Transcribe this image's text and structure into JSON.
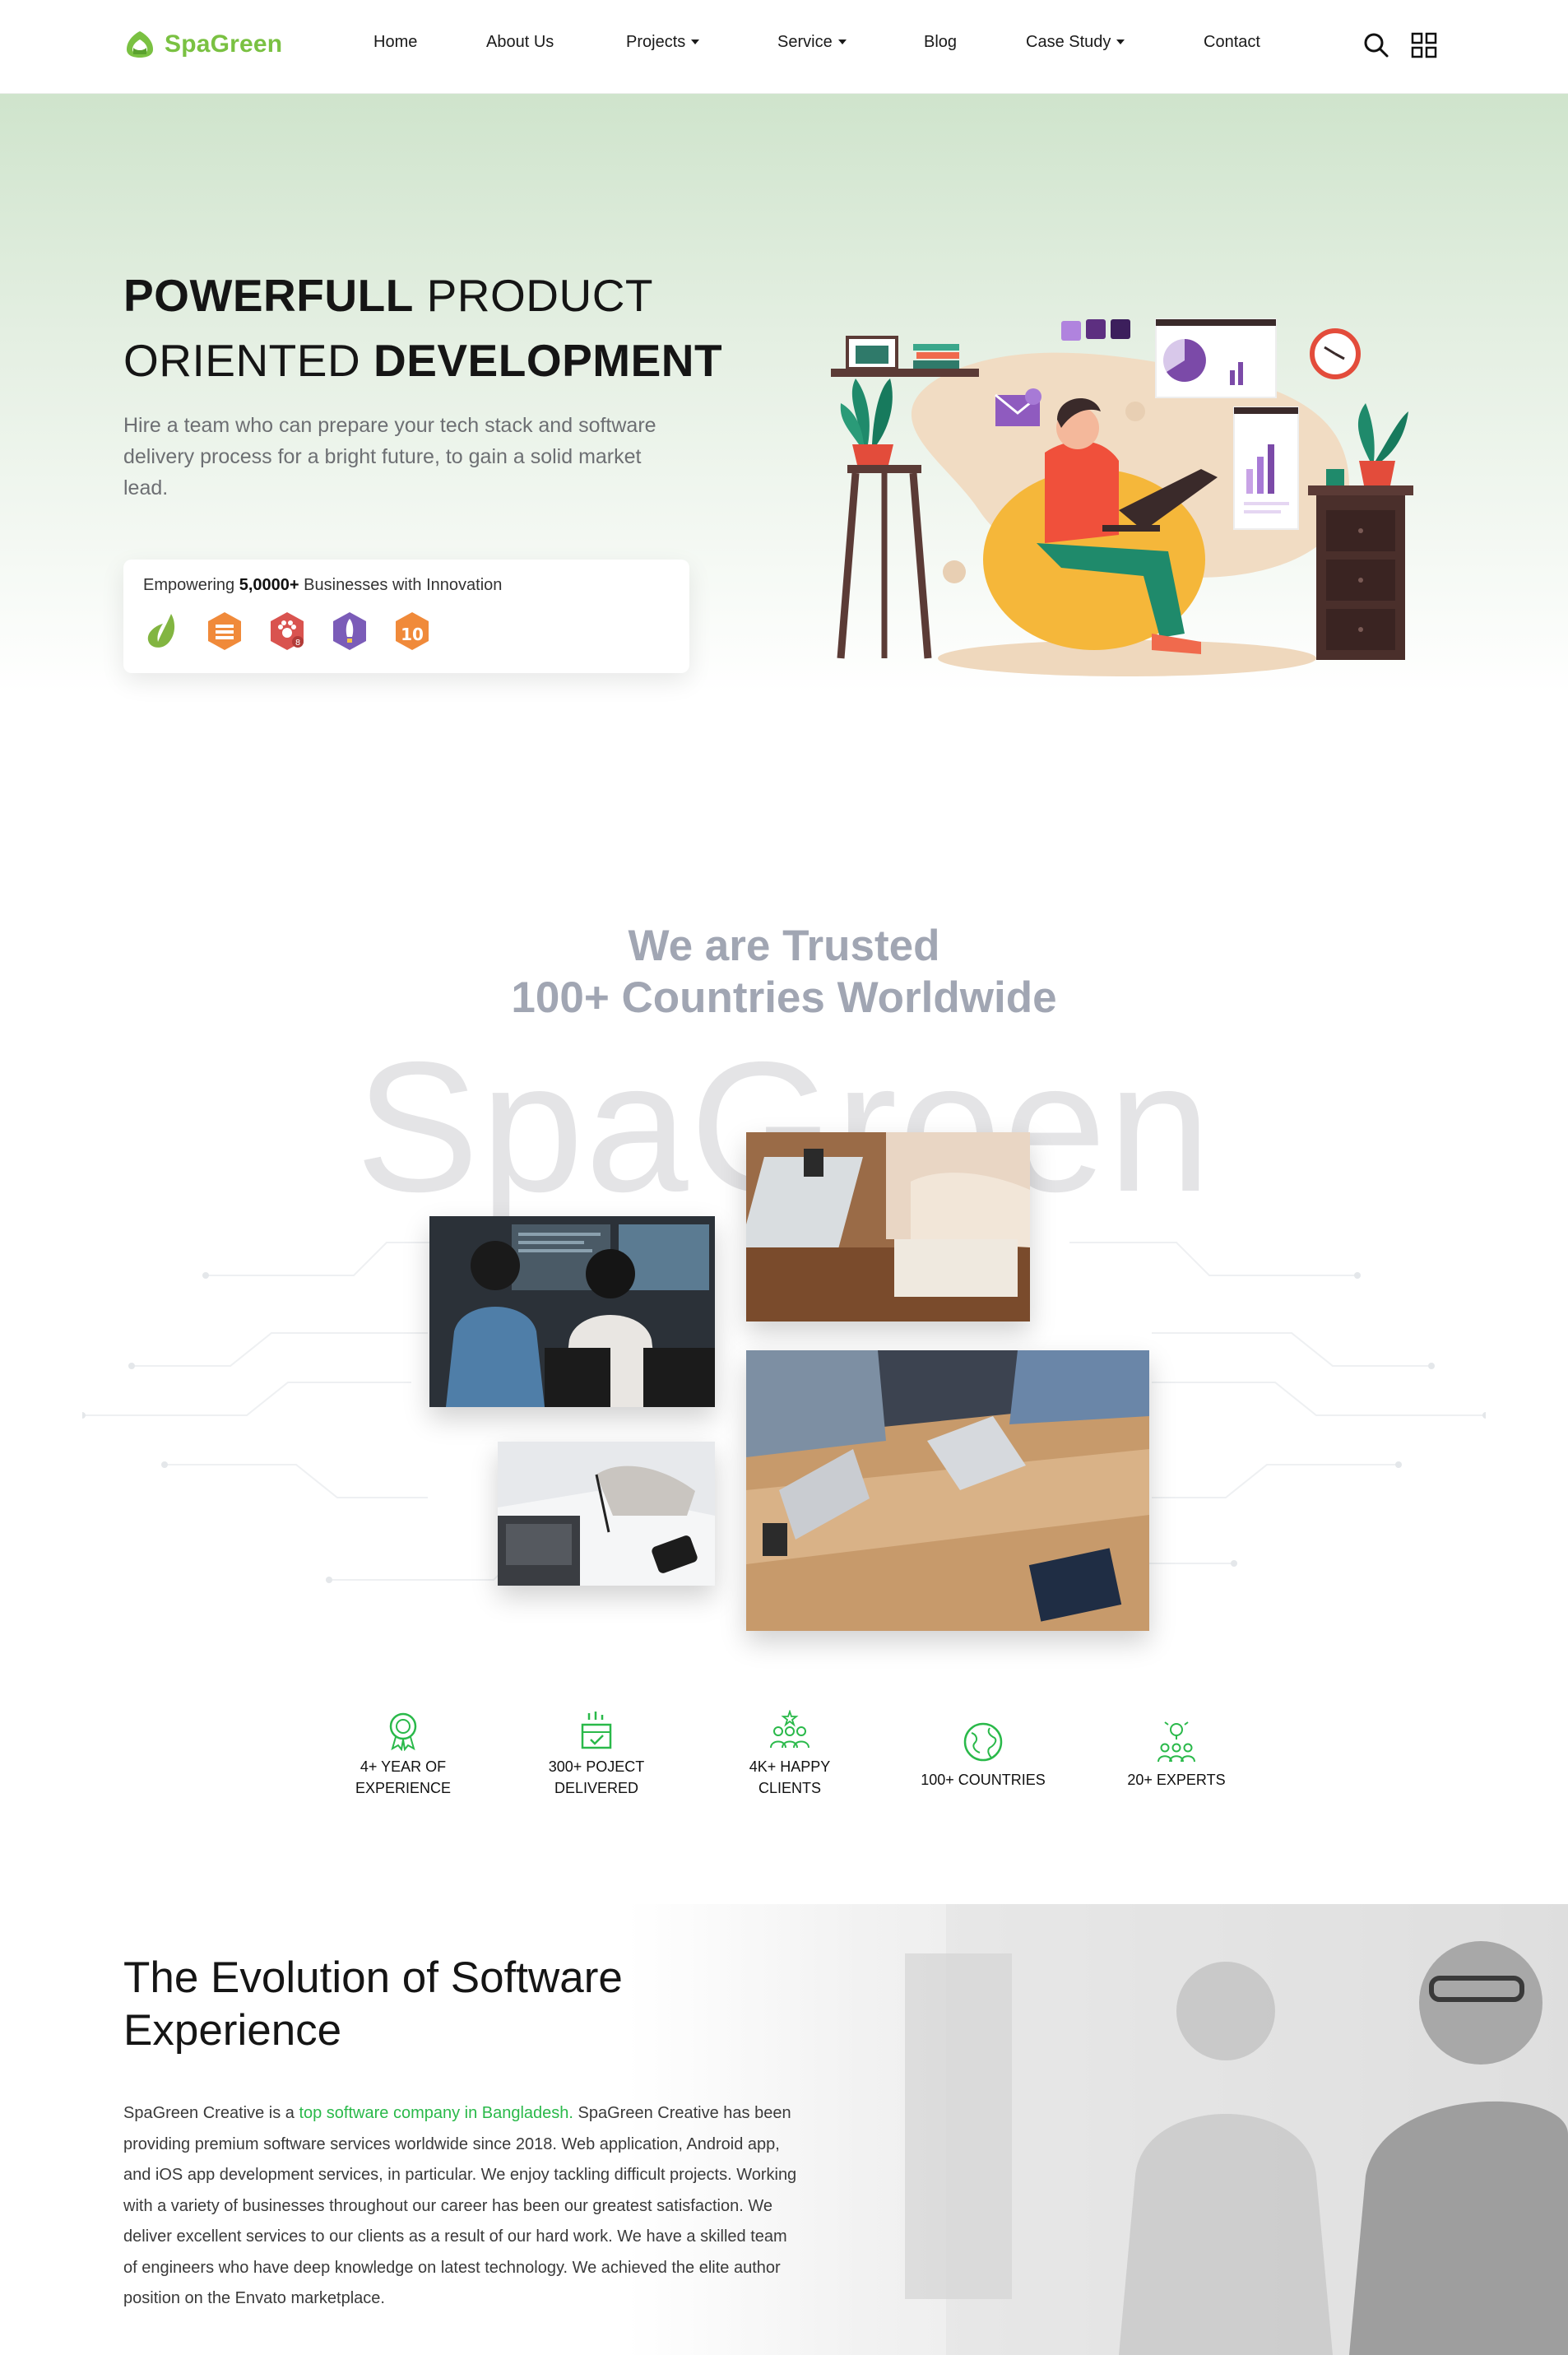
{
  "brand": {
    "name": "SpaGreen",
    "color": "#7ac142"
  },
  "nav": {
    "items": [
      {
        "label": "Home"
      },
      {
        "label": "About Us"
      },
      {
        "label": "Projects",
        "dropdown": true
      },
      {
        "label": "Service",
        "dropdown": true
      },
      {
        "label": "Blog"
      },
      {
        "label": "Case Study",
        "dropdown": true
      },
      {
        "label": "Contact"
      }
    ],
    "icons": [
      "search-icon",
      "grid-menu-icon"
    ]
  },
  "hero": {
    "line1_bold": "POWERFULL",
    "line1_light": "PRODUCT",
    "line2_light": "ORIENTED",
    "line2_bold": "DEVELOPMENT",
    "description": "Hire a team who can prepare your tech stack and software delivery process for a bright future, to gain a solid market lead.",
    "trust": {
      "prefix": "Empowering",
      "highlight": "5,0000+",
      "suffix": "Businesses with Innovation",
      "badges": [
        "envato-leaf-icon",
        "author-level-badge-icon",
        "paw-badge-icon",
        "rocket-badge-icon",
        "ten-years-badge-icon"
      ],
      "badge_colors": [
        "#82b541",
        "#f08a3a",
        "#d9534f",
        "#7b5cb8",
        "#f08a3a"
      ]
    }
  },
  "trusted": {
    "line1": "We are Trusted",
    "line2": "100+ Countries Worldwide",
    "watermark": "SpaGreen"
  },
  "stats": [
    {
      "line1": "4+ YEAR OF",
      "line2": "EXPERIENCE",
      "icon": "award-icon"
    },
    {
      "line1": "300+ POJECT",
      "line2": "DELIVERED",
      "icon": "project-delivered-icon"
    },
    {
      "line1": "4K+ HAPPY",
      "line2": "CLIENTS",
      "icon": "happy-clients-icon"
    },
    {
      "line1": "100+ COUNTRIES",
      "line2": "",
      "icon": "globe-icon"
    },
    {
      "line1": "20+ EXPERTS",
      "line2": "",
      "icon": "experts-icon"
    }
  ],
  "evolution": {
    "title_line1": "The Evolution of Software",
    "title_line2": "Experience",
    "text_before": "SpaGreen Creative is a ",
    "link": "top software company in Bangladesh.",
    "text_after": " SpaGreen Creative has been providing premium software services worldwide since 2018. Web application, Android app, and iOS app development services, in particular. We enjoy tackling difficult projects. Working with a variety of businesses throughout our career has been our greatest satisfaction. We deliver excellent services to our clients as a result of our hard work. We have a skilled team of engineers who have deep knowledge on latest technology. We achieved the elite author position on the Envato marketplace."
  },
  "colors": {
    "accent": "#2ab94a",
    "heading_gray": "#a1a6b3",
    "hero_green": "#cfe4cc"
  }
}
